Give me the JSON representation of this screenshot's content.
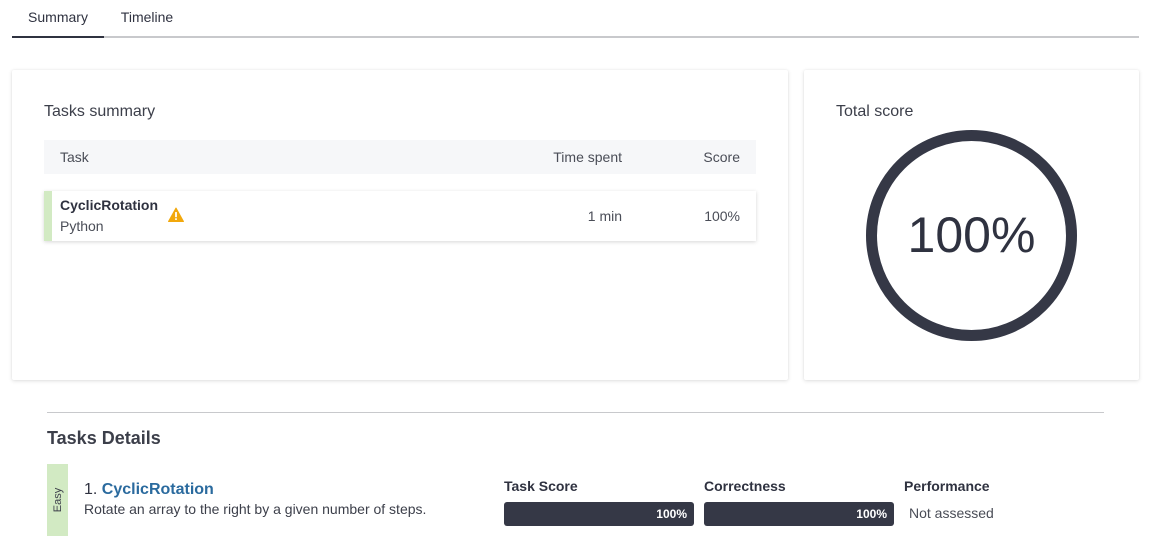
{
  "tabs": [
    {
      "label": "Summary",
      "active": true
    },
    {
      "label": "Timeline",
      "active": false
    }
  ],
  "tasks_summary": {
    "title": "Tasks summary",
    "columns": {
      "task": "Task",
      "time": "Time spent",
      "score": "Score"
    },
    "rows": [
      {
        "name": "CyclicRotation",
        "language": "Python",
        "warning_icon": "warning-icon",
        "time": "1 min",
        "score": "100%"
      }
    ]
  },
  "total_score": {
    "title": "Total score",
    "label": "100%",
    "fraction": 1.0,
    "ring_color": "#353846"
  },
  "tasks_details": {
    "title": "Tasks Details",
    "items": [
      {
        "difficulty": "Easy",
        "difficulty_color": "#d2eac3",
        "number": "1.",
        "name": "CyclicRotation",
        "description": "Rotate an array to the right by a given number of steps.",
        "metrics": {
          "task_score_label": "Task Score",
          "task_score_value": "100%",
          "task_score_fraction": 1.0,
          "correctness_label": "Correctness",
          "correctness_value": "100%",
          "correctness_fraction": 1.0,
          "performance_label": "Performance",
          "performance_value": "Not assessed"
        }
      }
    ]
  },
  "colors": {
    "accent_dark": "#353846",
    "link": "#2a6a9e",
    "warning": "#f2a80c",
    "easy": "#d2eac3"
  }
}
